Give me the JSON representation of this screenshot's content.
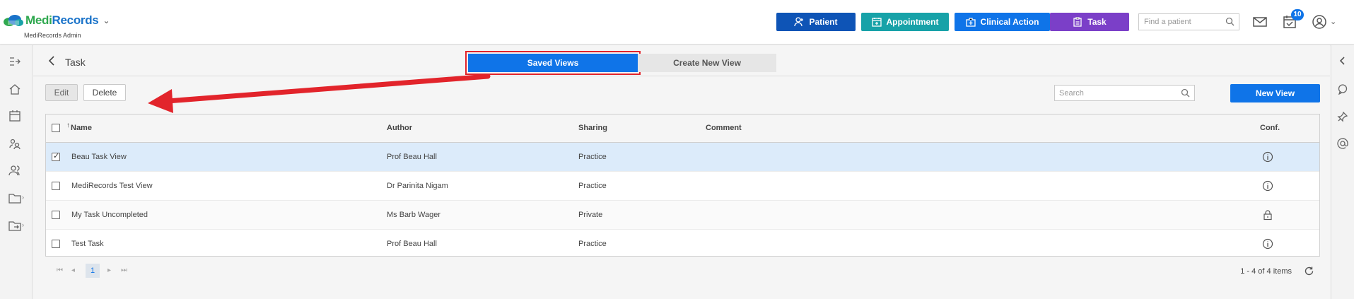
{
  "app": {
    "brand_part1": "Medi",
    "brand_part2": "Records",
    "subtitle": "MediRecords Admin"
  },
  "header": {
    "buttons": [
      {
        "label": "Patient"
      },
      {
        "label": "Appointment"
      },
      {
        "label": "Clinical Action"
      },
      {
        "label": "Task"
      }
    ],
    "find_placeholder": "Find a patient",
    "task_badge": "10"
  },
  "page": {
    "title": "Task",
    "tabs": [
      {
        "label": "Saved Views",
        "active": true
      },
      {
        "label": "Create New View",
        "active": false
      }
    ]
  },
  "toolbar": {
    "edit_label": "Edit",
    "delete_label": "Delete",
    "search_placeholder": "Search",
    "new_view_label": "New View"
  },
  "grid": {
    "columns": {
      "sort_indicator": "↑",
      "name": "Name",
      "author": "Author",
      "sharing": "Sharing",
      "comment": "Comment",
      "conf": "Conf."
    },
    "rows": [
      {
        "name": "Beau Task View",
        "author": "Prof Beau Hall",
        "sharing": "Practice",
        "comment": "",
        "conf_icon": "info-icon",
        "checked": true
      },
      {
        "name": "MediRecords Test View",
        "author": "Dr Parinita Nigam",
        "sharing": "Practice",
        "comment": "",
        "conf_icon": "info-icon",
        "checked": false
      },
      {
        "name": "My Task Uncompleted",
        "author": "Ms Barb Wager",
        "sharing": "Private",
        "comment": "",
        "conf_icon": "lock-icon",
        "checked": false
      },
      {
        "name": "Test Task",
        "author": "Prof Beau Hall",
        "sharing": "Practice",
        "comment": "",
        "conf_icon": "info-icon",
        "checked": false
      }
    ]
  },
  "pager": {
    "current_page": "1",
    "items_text": "1 - 4 of 4 items"
  },
  "colors": {
    "primary": "#0f74e8",
    "patient": "#0e54b6",
    "appointment": "#17a2a8",
    "task": "#7b3fc8",
    "selected_row": "#dcebfa",
    "annotation": "#e2242b"
  }
}
